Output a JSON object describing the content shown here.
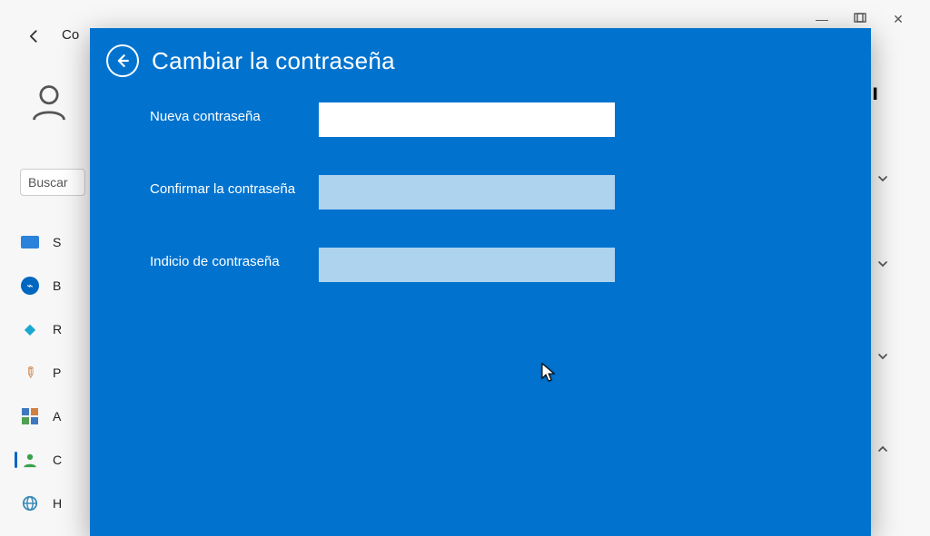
{
  "bg": {
    "crumb": "Co",
    "search_placeholder": "Buscar",
    "nav": [
      {
        "letter": "S"
      },
      {
        "letter": "B"
      },
      {
        "letter": "R"
      },
      {
        "letter": "P"
      },
      {
        "letter": "A"
      },
      {
        "letter": "C"
      },
      {
        "letter": "H"
      }
    ]
  },
  "modal": {
    "title": "Cambiar la contraseña",
    "new_pw_label": "Nueva contraseña",
    "confirm_pw_label": "Confirmar la contraseña",
    "hint_label": "Indicio de contraseña",
    "new_pw_value": "",
    "confirm_pw_value": "",
    "hint_value": ""
  }
}
